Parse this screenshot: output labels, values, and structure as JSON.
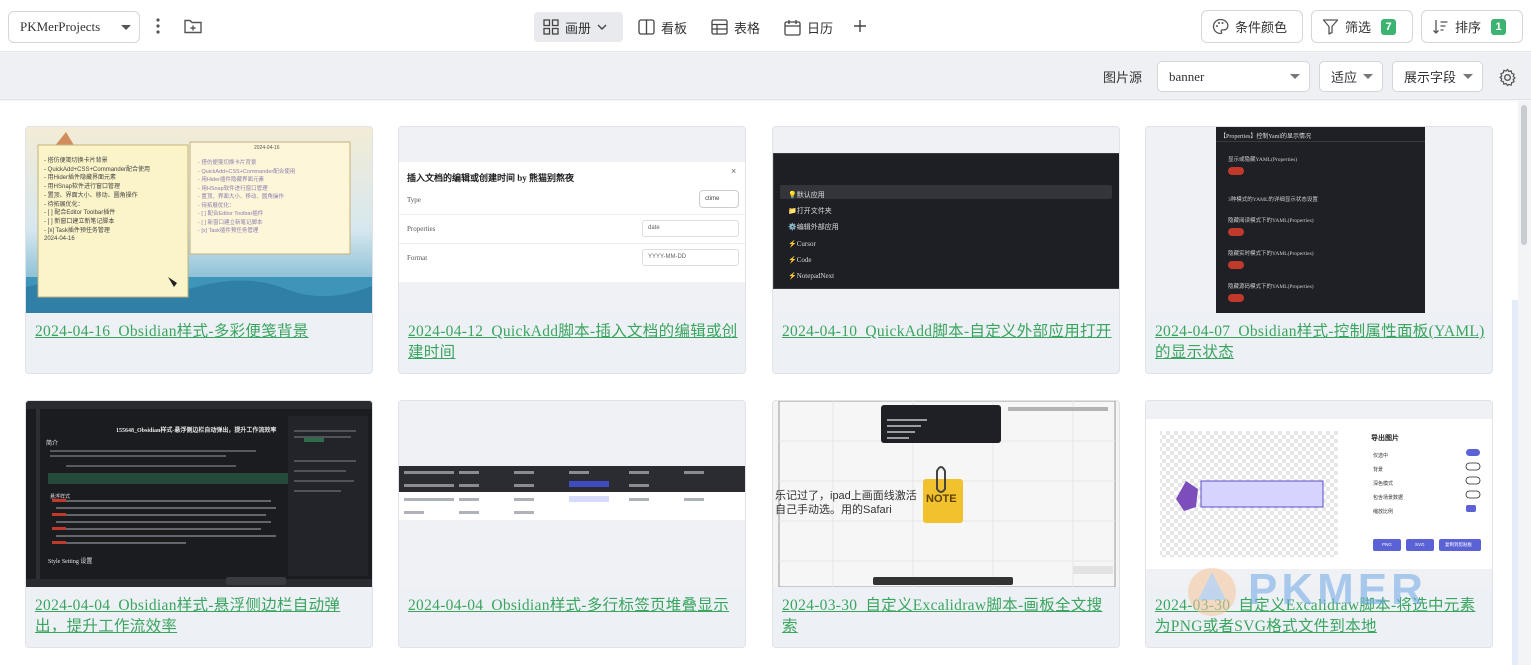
{
  "toolbar": {
    "project": "PKMerProjects",
    "views": [
      {
        "label": "画册",
        "icon": "grid-icon"
      },
      {
        "label": "看板",
        "icon": "kanban-icon"
      },
      {
        "label": "表格",
        "icon": "table-icon"
      },
      {
        "label": "日历",
        "icon": "calendar-icon"
      }
    ],
    "condition_color": "条件颜色",
    "filter": "筛选",
    "filter_count": "7",
    "sort": "排序",
    "sort_count": "1"
  },
  "subbar": {
    "image_source_label": "图片源",
    "image_source_value": "banner",
    "fit_value": "适应",
    "fields_value": "展示字段"
  },
  "cards": [
    {
      "title": "2024-04-16_Obsidian样式-多彩便笺背景"
    },
    {
      "title": "2024-04-12_QuickAdd脚本-插入文档的编辑或创建时间"
    },
    {
      "title": "2024-04-10_QuickAdd脚本-自定义外部应用打开"
    },
    {
      "title": "2024-04-07_Obsidian样式-控制属性面板(YAML)的显示状态"
    },
    {
      "title": "2024-04-04_Obsidian样式-悬浮侧边栏自动弹出，提升工作流效率"
    },
    {
      "title": "2024-04-04_Obsidian样式-多行标签页堆叠显示"
    },
    {
      "title": "2024-03-30_自定义Excalidraw脚本-画板全文搜索"
    },
    {
      "title": "2024-03-30_自定义Excalidraw脚本-将选中元素为PNG或者SVG格式文件到本地"
    }
  ],
  "thumbs": {
    "t1": {
      "left_lines": [
        "- 搭仿便笺切换卡片背景",
        "  - QuickAdd+CSS+Commander配合使用",
        "- 用Hider插件隐藏界面元素",
        "- 用HSnap软件进行窗口管理",
        "  - 置顶、界面大小、移动、圆角操作",
        "- 待拓展优化：",
        "  - [ ] 配合Editor Toolbar插件",
        "  - [ ] 新窗口建立新笔记脚本",
        "  - [x] Task插件预任务管理",
        "2024-04-16"
      ],
      "right_date": "2024-04-16"
    },
    "t2": {
      "dialog_title": "插入文档的编辑或创建时间 by 熊猫别熬夜",
      "rows": [
        {
          "label": "Type",
          "value": "ctime"
        },
        {
          "label": "Properties",
          "value": "date"
        },
        {
          "label": "Format",
          "value": "YYYY-MM-DD"
        }
      ]
    },
    "t3": {
      "items": [
        "💡默认应用",
        "📁打开文件夹",
        "⚙️编辑外部应用",
        "⚡Cursor",
        "⚡Code",
        "⚡NotepadNext"
      ]
    },
    "t4": {
      "header": "【Properties】控制Yaml的显示情况",
      "items": [
        "显示或隐藏YAML(Properties)",
        "3种模式的YAML的详细显示状态设置",
        "隐藏阅读模式下的YAML(Properties)",
        "隐藏实时模式下的YAML(Properties)",
        "隐藏源码模式下的YAML(Properties)"
      ]
    },
    "t5": {
      "title": "155648_Obsidian样式-悬浮侧边栏自动弹出，提升工作流效率",
      "section1": "简介",
      "section2": "悬浮样式",
      "section3": "Style Setting 设置"
    },
    "t7": {
      "note": "NOTE",
      "text_line1": "乐记过了，ipad上画面线激活",
      "text_line2": "自己手动选。用的Safari"
    },
    "t8": {
      "panel_title": "导出图片",
      "options": [
        "仅选中",
        "背景",
        "深色模式",
        "包含场景数据",
        "缩放比例"
      ],
      "buttons": [
        "PNG",
        "SVG",
        "复制到剪贴板"
      ]
    }
  },
  "watermark": "PKMER",
  "colors": {
    "accent_green": "#3aa55f",
    "badge_green": "#3cb371",
    "dark_bg": "#1e1f24"
  }
}
